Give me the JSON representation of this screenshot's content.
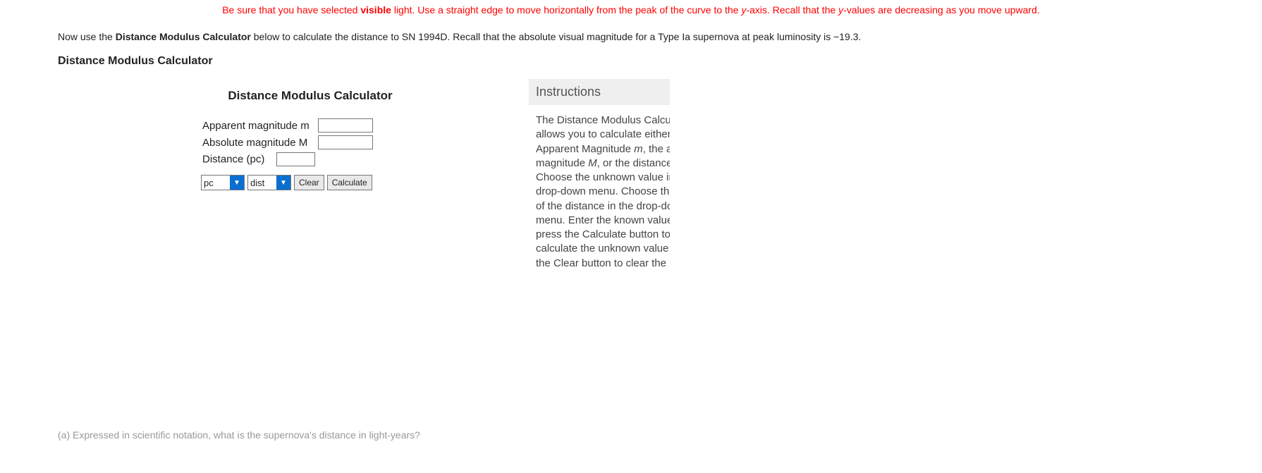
{
  "hint": {
    "pre": "Be sure that you have selected ",
    "bold": "visible",
    "mid1": " light. Use a straight edge to move horizontally from the peak of the curve to the ",
    "yax1": "y",
    "mid2": "-axis. Recall that the ",
    "yax2": "y",
    "post": "-values are decreasing as you move upward."
  },
  "intro": {
    "pre": "Now use the ",
    "bold": "Distance Modulus Calculator",
    "post": " below to calculate the distance to SN 1994D. Recall that the absolute visual magnitude for a Type Ia supernova at peak luminosity is −19.3."
  },
  "section_title": "Distance Modulus Calculator",
  "calc": {
    "title": "Distance Modulus Calculator",
    "row1": "Apparent magnitude m",
    "row2": "Absolute magnitude M",
    "row3": "Distance (pc)",
    "sel_unit": "pc",
    "sel_var": "dist",
    "clear": "Clear",
    "calculate": "Calculate"
  },
  "instr": {
    "head": "Instructions",
    "body_html": "The Distance Modulus Calculator allows you to calculate either the Apparent Magnitude <span class=\"ital\">m</span>, the absolute magnitude <span class=\"ital\">M</span>, or the distance. Choose the unknown value in the drop-down menu. Choose the units of the distance in the drop-down menu. Enter the known values and press the Calculate button to calculate the unknown value. Press the Clear button to clear the results."
  },
  "cutoff": "(a)   Expressed in scientific notation, what is the supernova's distance in light-years?"
}
